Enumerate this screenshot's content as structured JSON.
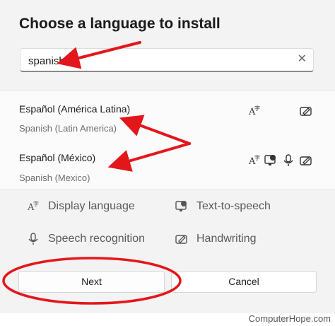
{
  "dialog": {
    "title": "Choose a language to install"
  },
  "search": {
    "value": "spanish",
    "clear_icon": "close-icon"
  },
  "results": [
    {
      "name": "Español (América Latina)",
      "subtitle": "Spanish (Latin America)",
      "features": [
        "display-language-icon",
        "handwriting-icon"
      ]
    },
    {
      "name": "Español (México)",
      "subtitle": "Spanish (Mexico)",
      "features": [
        "display-language-icon",
        "text-to-speech-icon",
        "speech-recognition-icon",
        "handwriting-icon"
      ]
    }
  ],
  "legend": {
    "display_language": "Display language",
    "text_to_speech": "Text-to-speech",
    "speech_recognition": "Speech recognition",
    "handwriting": "Handwriting"
  },
  "buttons": {
    "next": "Next",
    "cancel": "Cancel"
  },
  "watermark": "ComputerHope.com",
  "colors": {
    "annotation_red": "#e3171b",
    "dialog_bg": "#f3f3f3",
    "list_bg": "#fbfbfb"
  }
}
